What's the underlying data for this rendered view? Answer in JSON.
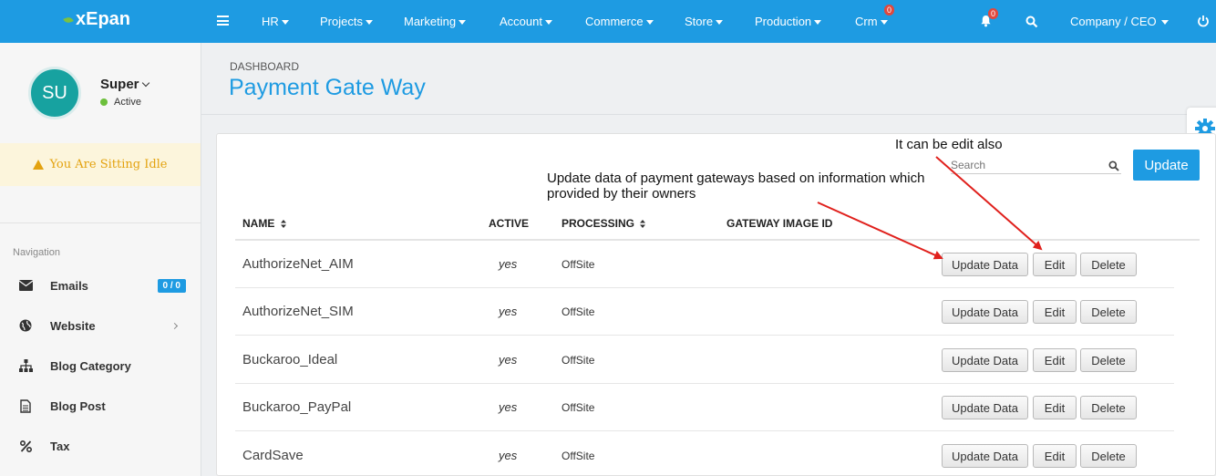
{
  "app": {
    "brand": "xEpan"
  },
  "topnav": {
    "items": [
      {
        "label": "HR"
      },
      {
        "label": "Projects"
      },
      {
        "label": "Marketing"
      },
      {
        "label": "Account"
      },
      {
        "label": "Commerce"
      },
      {
        "label": "Store"
      },
      {
        "label": "Production"
      },
      {
        "label": "Crm"
      }
    ],
    "crm_badge": "0",
    "notification_badge": "0",
    "company": "Company / CEO"
  },
  "user": {
    "initials": "SU",
    "name": "Super",
    "status": "Active"
  },
  "idle_notice": "You Are Sitting Idle",
  "navigation": {
    "label": "Navigation",
    "items": [
      {
        "label": "Emails",
        "icon": "envelope-icon",
        "badge": "0 / 0"
      },
      {
        "label": "Website",
        "icon": "globe-icon"
      },
      {
        "label": "Blog Category",
        "icon": "sitemap-icon"
      },
      {
        "label": "Blog Post",
        "icon": "document-icon"
      },
      {
        "label": "Tax",
        "icon": "percent-icon"
      }
    ]
  },
  "page": {
    "breadcrumb": "DASHBOARD",
    "title": "Payment Gate Way"
  },
  "toolbar": {
    "search_placeholder": "Search",
    "update_label": "Update"
  },
  "table": {
    "columns": [
      "NAME",
      "ACTIVE",
      "PROCESSING",
      "GATEWAY IMAGE ID"
    ],
    "rows": [
      {
        "name": "AuthorizeNet_AIM",
        "active": "yes",
        "processing": "OffSite"
      },
      {
        "name": "AuthorizeNet_SIM",
        "active": "yes",
        "processing": "OffSite"
      },
      {
        "name": "Buckaroo_Ideal",
        "active": "yes",
        "processing": "OffSite"
      },
      {
        "name": "Buckaroo_PayPal",
        "active": "yes",
        "processing": "OffSite"
      },
      {
        "name": "CardSave",
        "active": "yes",
        "processing": "OffSite"
      }
    ],
    "actions": {
      "update_data": "Update Data",
      "edit": "Edit",
      "delete": "Delete"
    }
  },
  "annotations": {
    "edit_note": "It can be edit also",
    "update_note_line1": "Update data of payment gateways based on information which",
    "update_note_line2": "provided by their owners"
  },
  "colors": {
    "primary": "#1e9be2",
    "arrow": "#e0201c",
    "idle_text": "#e3a20f",
    "avatar": "#17a2a0"
  }
}
